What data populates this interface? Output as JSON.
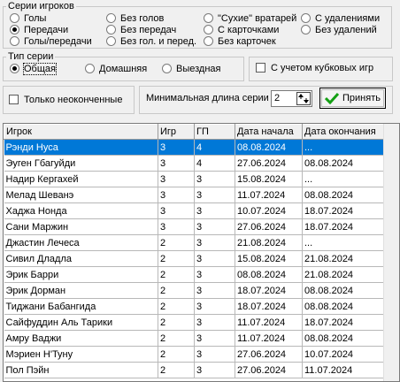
{
  "player_series": {
    "legend": "Серии игроков",
    "options": [
      {
        "label": "Голы",
        "selected": false
      },
      {
        "label": "Передачи",
        "selected": true
      },
      {
        "label": "Голы/передачи",
        "selected": false
      },
      {
        "label": "Без голов",
        "selected": false
      },
      {
        "label": "Без передач",
        "selected": false
      },
      {
        "label": "Без гол. и перед.",
        "selected": false
      },
      {
        "label": "\"Сухие\" вратарей",
        "selected": false
      },
      {
        "label": "С карточками",
        "selected": false
      },
      {
        "label": "Без карточек",
        "selected": false
      },
      {
        "label": "С удалениями",
        "selected": false
      },
      {
        "label": "Без удалений",
        "selected": false
      }
    ]
  },
  "series_type": {
    "legend": "Тип серии",
    "options": [
      {
        "label": "Общая",
        "selected": true
      },
      {
        "label": "Домашняя",
        "selected": false
      },
      {
        "label": "Выездная",
        "selected": false
      }
    ]
  },
  "cup_games": {
    "label": "С учетом кубковых игр",
    "checked": false
  },
  "unfinished_only": {
    "label": "Только неоконченные",
    "checked": false
  },
  "min_length": {
    "label": "Минимальная длина серии",
    "value": "2"
  },
  "apply_button": {
    "label": "Принять"
  },
  "colors": {
    "accent": "#0078d7",
    "check_icon": "#14a014"
  },
  "table": {
    "columns": [
      "Игрок",
      "Игр",
      "ГП",
      "Дата начала",
      "Дата окончания"
    ],
    "rows": [
      [
        "Рэнди Нуса",
        "3",
        "4",
        "08.08.2024",
        "..."
      ],
      [
        "Эуген Гбагуйди",
        "3",
        "4",
        "27.06.2024",
        "08.08.2024"
      ],
      [
        "Надир Кергахей",
        "3",
        "3",
        "15.08.2024",
        "..."
      ],
      [
        "Мелад Шеванэ",
        "3",
        "3",
        "11.07.2024",
        "08.08.2024"
      ],
      [
        "Хаджа Нонда",
        "3",
        "3",
        "10.07.2024",
        "18.07.2024"
      ],
      [
        "Сани Маржин",
        "3",
        "3",
        "27.06.2024",
        "18.07.2024"
      ],
      [
        "Джастин Лечеса",
        "2",
        "3",
        "21.08.2024",
        "..."
      ],
      [
        "Сивил Дладла",
        "2",
        "3",
        "15.08.2024",
        "21.08.2024"
      ],
      [
        "Эрик Барри",
        "2",
        "3",
        "08.08.2024",
        "21.08.2024"
      ],
      [
        "Эрик Дорман",
        "2",
        "3",
        "18.07.2024",
        "08.08.2024"
      ],
      [
        "Тиджани Бабангида",
        "2",
        "3",
        "18.07.2024",
        "08.08.2024"
      ],
      [
        "Сайфуддин Аль Тарики",
        "2",
        "3",
        "11.07.2024",
        "18.07.2024"
      ],
      [
        "Амру Ваджи",
        "2",
        "3",
        "11.07.2024",
        "08.08.2024"
      ],
      [
        "Мэриен Н'Туну",
        "2",
        "3",
        "27.06.2024",
        "10.07.2024"
      ],
      [
        "Пол Пэйн",
        "2",
        "3",
        "27.06.2024",
        "11.07.2024"
      ]
    ],
    "selected_row": 0
  }
}
